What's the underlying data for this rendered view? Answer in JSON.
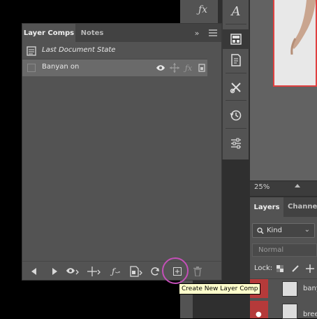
{
  "layer_comps_panel": {
    "tabs": [
      {
        "label": "Layer Comps",
        "active": true
      },
      {
        "label": "Notes",
        "active": false
      }
    ],
    "rows": [
      {
        "label": "Last Document State",
        "italic": true,
        "selected": false
      },
      {
        "label": "Banyan on",
        "italic": false,
        "selected": true
      }
    ],
    "row_icons": [
      "visibility-icon",
      "position-icon",
      "fx-icon",
      "appearance-icon"
    ],
    "footer_buttons": [
      "previous-comp-button",
      "next-comp-button",
      "update-visibility-button",
      "update-position-button",
      "update-style-button",
      "update-smart-object-button",
      "update-comp-button",
      "create-new-comp-button",
      "delete-comp-button"
    ]
  },
  "tooltip": {
    "text": "Create New Layer Comp"
  },
  "canvas": {
    "zoom": "25%"
  },
  "layers_panel": {
    "tabs": [
      {
        "label": "Layers",
        "active": true
      },
      {
        "label": "Channels",
        "active": false
      }
    ],
    "filter_kind": "Kind",
    "blend_mode": "Normal",
    "lock_label": "Lock:",
    "layers": [
      {
        "name": "bany"
      },
      {
        "name": "bree"
      }
    ]
  },
  "colors": {
    "highlight_circle": "#c44fb8",
    "tooltip_bg": "#ffffcc",
    "selected_row": "#6a6a6a",
    "panel_bg": "#535353",
    "layer_visibility_red": "#b53a3a"
  }
}
